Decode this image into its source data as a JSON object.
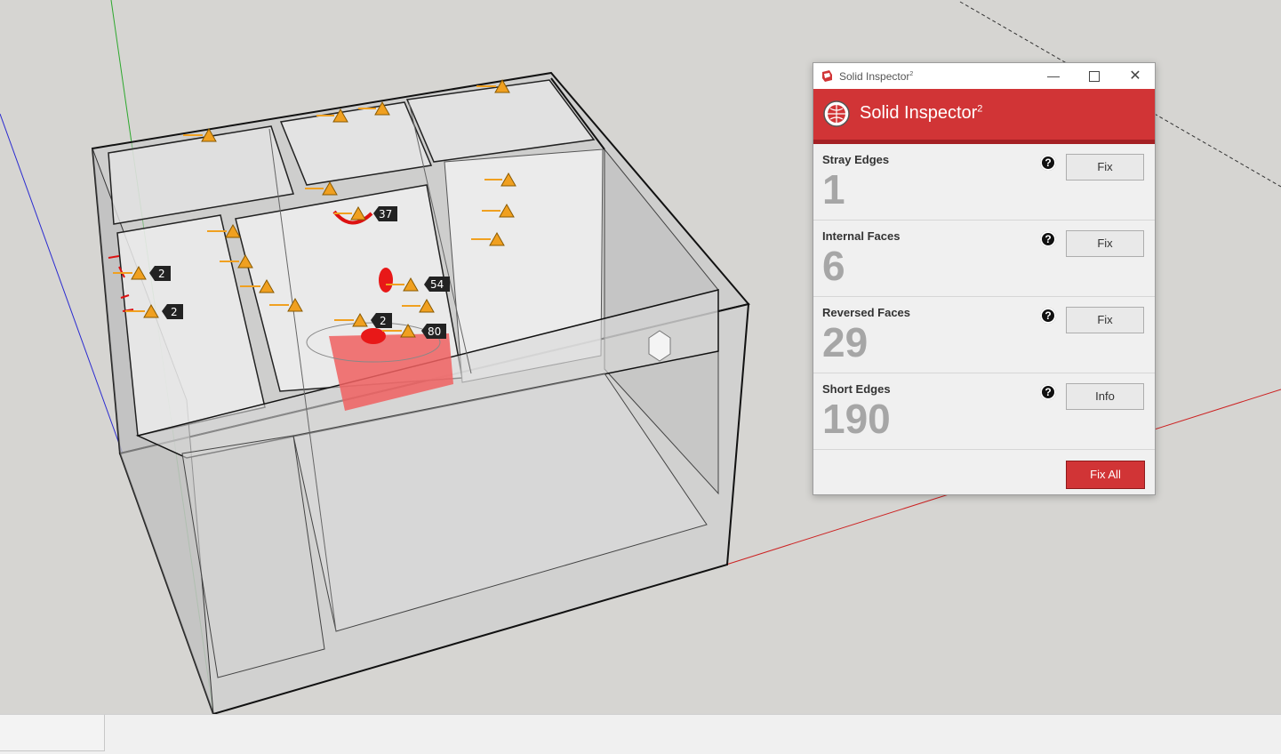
{
  "window": {
    "title": "Solid Inspector",
    "title_sup": "2",
    "heading": "Solid Inspector",
    "heading_sup": "2",
    "minimize_glyph": "—",
    "close_glyph": "✕"
  },
  "checks": [
    {
      "label": "Stray Edges",
      "count": "1",
      "button": "Fix",
      "help": "?"
    },
    {
      "label": "Internal Faces",
      "count": "6",
      "button": "Fix",
      "help": "?"
    },
    {
      "label": "Reversed Faces",
      "count": "29",
      "button": "Fix",
      "help": "?"
    },
    {
      "label": "Short Edges",
      "count": "190",
      "button": "Info",
      "help": "?"
    }
  ],
  "fix_all_label": "Fix All",
  "callouts": [
    "37",
    "2",
    "2",
    "54",
    "2",
    "80"
  ],
  "colors": {
    "accent_red": "#d13436",
    "warning_orange": "#f0a020",
    "axis_red": "#cc2222",
    "axis_green": "#22aa22",
    "axis_blue": "#2222cc"
  },
  "icons": {
    "app": "sketchup-icon",
    "logo": "solid-inspector-logo",
    "warning": "warning-triangle-icon",
    "help": "help-icon"
  }
}
